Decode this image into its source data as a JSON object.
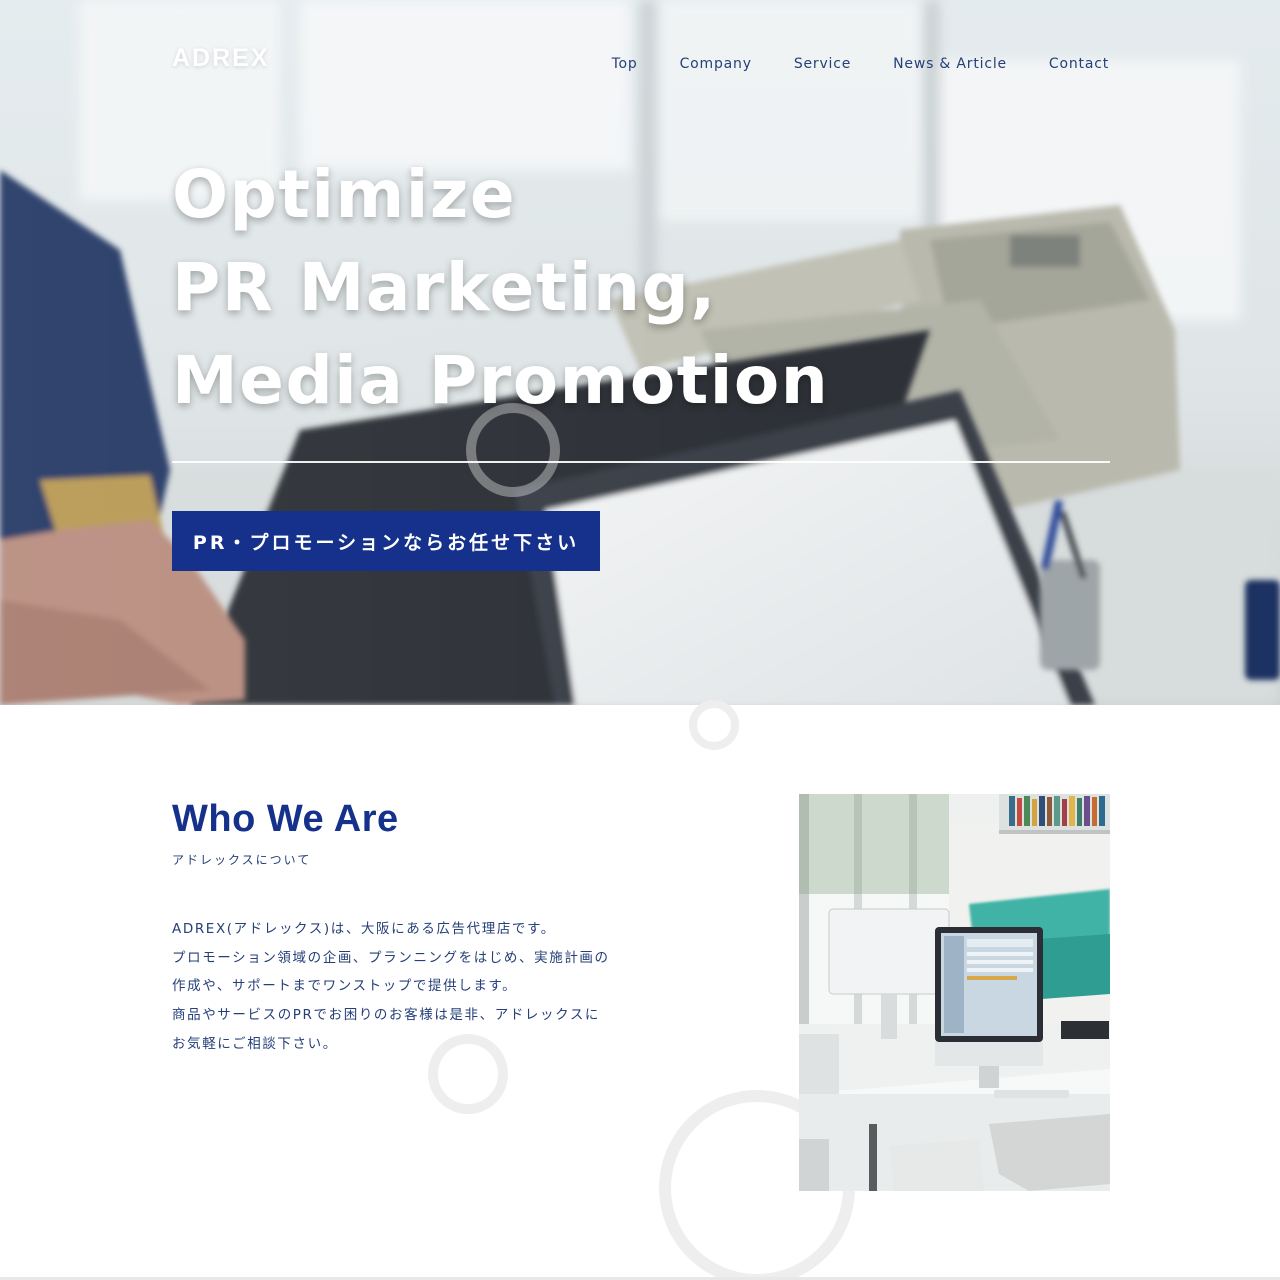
{
  "header": {
    "logo": "ADREX",
    "nav": [
      "Top",
      "Company",
      "Service",
      "News & Article",
      "Contact"
    ]
  },
  "hero": {
    "headline": [
      "Optimize",
      "PR Marketing,",
      "Media Promotion"
    ],
    "cta_label": "PR・プロモーションならお任せ下さい"
  },
  "about": {
    "title": "Who We Are",
    "subtitle": "アドレックスについて",
    "body": [
      "ADREX(アドレックス)は、大阪にある広告代理店です。",
      "プロモーション領域の企画、プランニングをはじめ、実施計画の",
      "作成や、サポートまでワンストップで提供します。",
      "商品やサービスのPRでお困りのお客様は是非、アドレックスに",
      "お気軽にご相談下さい。"
    ]
  },
  "colors": {
    "brand_navy": "#15318c",
    "nav_text": "#27407a",
    "white": "#ffffff"
  }
}
